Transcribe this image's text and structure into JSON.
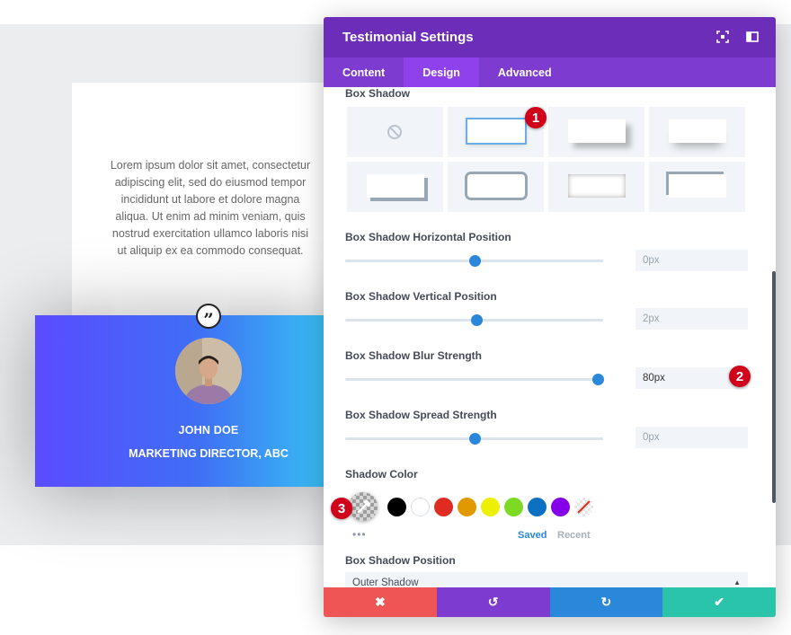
{
  "testimonial": {
    "body": "Lorem ipsum dolor sit amet, consectetur adipiscing elit, sed do eiusmod tempor incididunt ut labore et dolore magna aliqua. Ut enim ad minim veniam, quis nostrud exercitation ullamco laboris nisi ut aliquip ex ea commodo consequat.",
    "quote_glyph": "”",
    "name": "JOHN DOE",
    "role": "MARKETING DIRECTOR, ABC"
  },
  "modal": {
    "title": "Testimonial Settings",
    "tabs": [
      {
        "label": "Content",
        "active": false
      },
      {
        "label": "Design",
        "active": true
      },
      {
        "label": "Advanced",
        "active": false
      }
    ],
    "box_shadow_label": "Box Shadow",
    "sliders": [
      {
        "label": "Box Shadow Horizontal Position",
        "value": "0px",
        "fraction": 0.5
      },
      {
        "label": "Box Shadow Vertical Position",
        "value": "2px",
        "fraction": 0.51
      },
      {
        "label": "Box Shadow Blur Strength",
        "value": "80px",
        "fraction": 0.98
      },
      {
        "label": "Box Shadow Spread Strength",
        "value": "0px",
        "fraction": 0.5
      }
    ],
    "shadow_color_label": "Shadow Color",
    "swatches": [
      "#000000",
      "#ffffff",
      "#e02b20",
      "#e09900",
      "#edf000",
      "#7cda24",
      "#0c71c3",
      "#8300e9"
    ],
    "saved_label": "Saved",
    "recent_label": "Recent",
    "shadow_position_label": "Box Shadow Position",
    "shadow_position_value": "Outer Shadow",
    "footer_colors": {
      "cancel": "#ef5555",
      "undo": "#7e3bd0",
      "redo": "#2b87da",
      "save": "#29c4a9"
    }
  },
  "markers": [
    "1",
    "2",
    "3"
  ]
}
